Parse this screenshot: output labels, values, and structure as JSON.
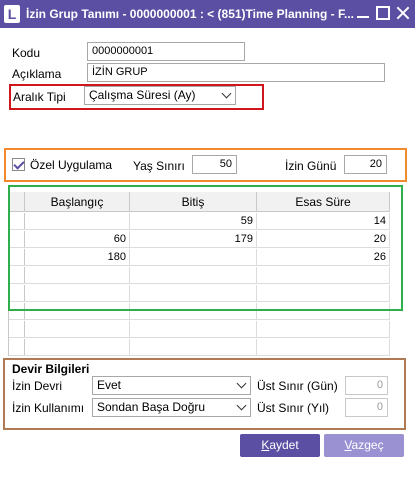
{
  "window": {
    "title": "İzin Grup Tanımı - 0000000001 : < (851)Time Planning - F...",
    "app_icon_letter": "L"
  },
  "form": {
    "kodu_label": "Kodu",
    "kodu_value": "0000000001",
    "aciklama_label": "Açıklama",
    "aciklama_value": "İZİN GRUP",
    "aralik_tipi_label": "Aralık Tipi",
    "aralik_tipi_value": "Çalışma Süresi (Ay)"
  },
  "ozel": {
    "checkbox_label": "Özel Uygulama",
    "checked": true,
    "yas_siniri_label": "Yaş Sınırı",
    "yas_siniri_value": "50",
    "izin_gunu_label": "İzin Günü",
    "izin_gunu_value": "20"
  },
  "grid": {
    "columns": [
      "Başlangıç",
      "Bitiş",
      "Esas Süre"
    ],
    "rows": [
      [
        "",
        "59",
        "14"
      ],
      [
        "60",
        "179",
        "20"
      ],
      [
        "180",
        "",
        "26"
      ],
      [
        "",
        "",
        ""
      ],
      [
        "",
        "",
        ""
      ],
      [
        "",
        "",
        ""
      ],
      [
        "",
        "",
        ""
      ],
      [
        "",
        "",
        ""
      ]
    ]
  },
  "devir": {
    "title": "Devir Bilgileri",
    "izin_devri_label": "İzin Devri",
    "izin_devri_value": "Evet",
    "izin_kullanimi_label": "İzin Kullanımı",
    "izin_kullanimi_value": "Sondan Başa Doğru",
    "ust_sinir_gun_label": "Üst Sınır (Gün)",
    "ust_sinir_gun_value": "0",
    "ust_sinir_yil_label": "Üst Sınır (Yıl)",
    "ust_sinir_yil_value": "0"
  },
  "buttons": {
    "save_first": "K",
    "save_rest": "aydet",
    "cancel_first": "V",
    "cancel_rest": "azgeç"
  },
  "colors": {
    "title_bar": "#5a4fa3",
    "save_button": "#5a4fa3",
    "cancel_button": "#9a91d3",
    "red_highlight": "#d0161b",
    "orange_highlight": "#f08a2d",
    "green_highlight": "#2fae4a",
    "brown_highlight": "#b07a52"
  }
}
